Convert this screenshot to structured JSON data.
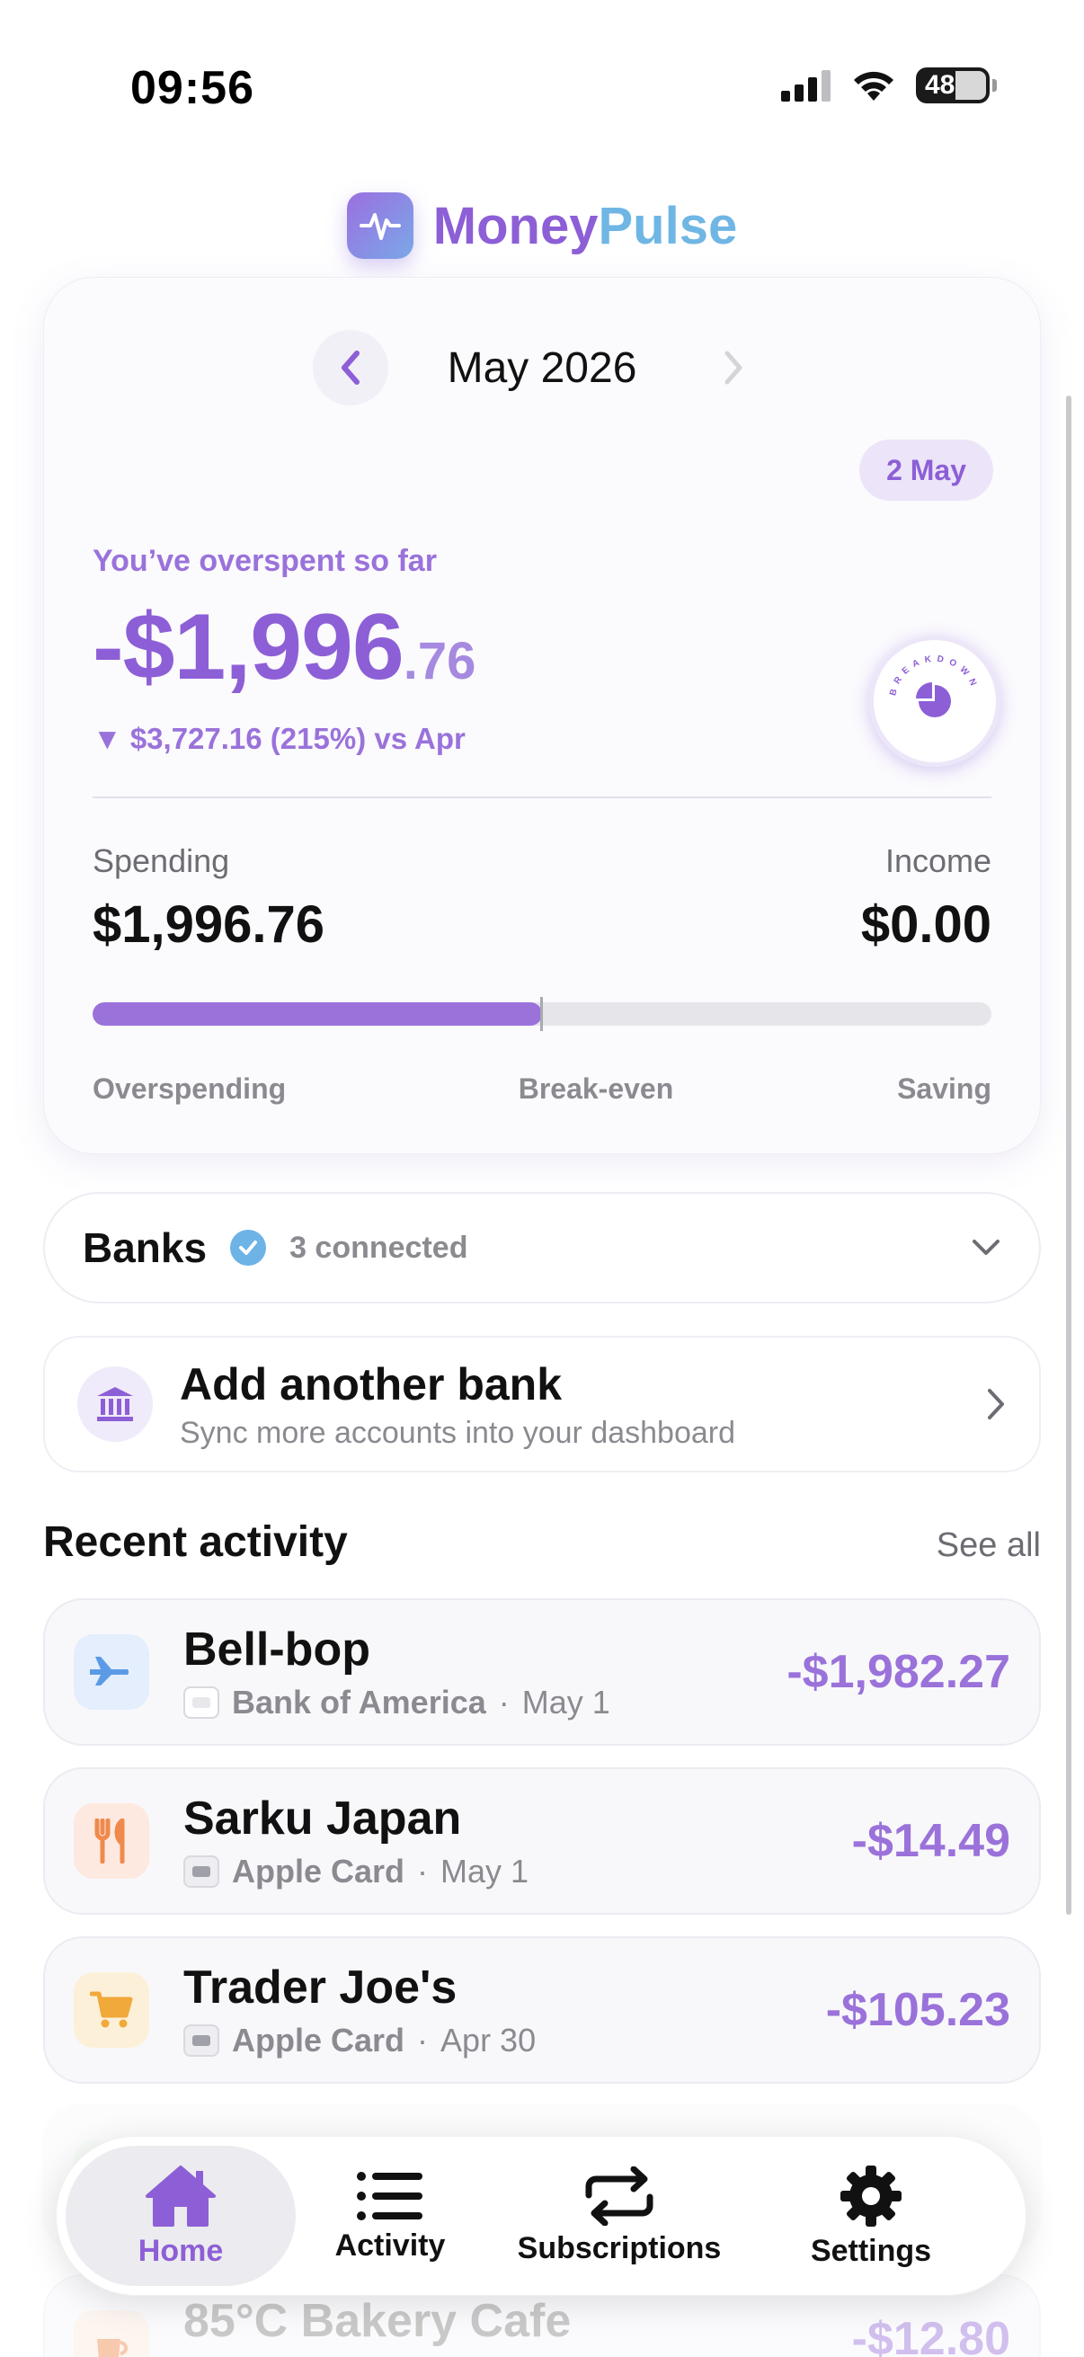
{
  "status_bar": {
    "time": "09:56",
    "battery": "48"
  },
  "brand": {
    "money": "Money",
    "pulse": "Pulse"
  },
  "summary": {
    "month": "May 2026",
    "date_pill": "2 May",
    "overspent_label": "You’ve overspent so far",
    "amount_main": "-$1,996",
    "amount_cents": ".76",
    "vs_line": "▼ $3,727.16 (215%) vs Apr",
    "breakdown_label": "BREAKDOWN",
    "spending_label": "Spending",
    "spending_value": "$1,996.76",
    "income_label": "Income",
    "income_value": "$0.00",
    "progress_fraction": 0.5,
    "scale_left": "Overspending",
    "scale_mid": "Break-even",
    "scale_right": "Saving"
  },
  "banks": {
    "title": "Banks",
    "count": "3 connected"
  },
  "add_bank": {
    "title": "Add another bank",
    "subtitle": "Sync more accounts into your dashboard"
  },
  "recent": {
    "title": "Recent activity",
    "see_all": "See all",
    "items": [
      {
        "name": "Bell-bop",
        "account": "Bank of America",
        "date": "May 1",
        "amount": "-$1,982.27",
        "icon": "airplane-icon"
      },
      {
        "name": "Sarku Japan",
        "account": "Apple Card",
        "date": "May 1",
        "amount": "-$14.49",
        "icon": "fork-knife-icon"
      },
      {
        "name": "Trader Joe's",
        "account": "Apple Card",
        "date": "Apr 30",
        "amount": "-$105.23",
        "icon": "cart-icon"
      },
      {
        "name": "85°C Bakery Cafe",
        "amount": "-$12.80",
        "icon": "cup-icon"
      }
    ]
  },
  "nav": {
    "home": "Home",
    "activity": "Activity",
    "subscriptions": "Subscriptions",
    "settings": "Settings"
  },
  "colors": {
    "accent": "#8d5fd6",
    "pulse": "#6fb6e4",
    "verified": "#6db3e6"
  }
}
